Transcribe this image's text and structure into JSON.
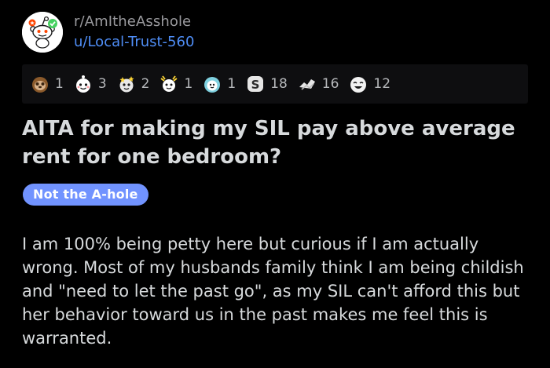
{
  "post": {
    "subreddit": "r/AmItheAsshole",
    "author": "u/Local-Trust-560",
    "title": "AITA for making my SIL pay above average rent for one bedroom?",
    "flair": "Not the A-hole",
    "flair_color": "#7193ff",
    "body": "I am 100% being petty here but curious if I am actually wrong. Most of my husbands family think I am being childish and \"need to let the past go\", as my SIL can't afford this but her behavior toward us in the past makes me feel this is warranted."
  },
  "awards": [
    {
      "icon": "sloth-award-icon",
      "count": "1"
    },
    {
      "icon": "wholesome-award-icon",
      "count": "3"
    },
    {
      "icon": "starstruck-award-icon",
      "count": "2"
    },
    {
      "icon": "take-my-energy-award-icon",
      "count": "1"
    },
    {
      "icon": "wholesome-seal-award-icon",
      "count": "1"
    },
    {
      "icon": "silver-award-icon",
      "count": "18"
    },
    {
      "icon": "helpful-award-icon",
      "count": "16"
    },
    {
      "icon": "laughing-award-icon",
      "count": "12"
    }
  ],
  "colors": {
    "background": "#000000",
    "text": "#d7dadc",
    "muted": "#9a9a9e",
    "link": "#4f8ef7"
  }
}
